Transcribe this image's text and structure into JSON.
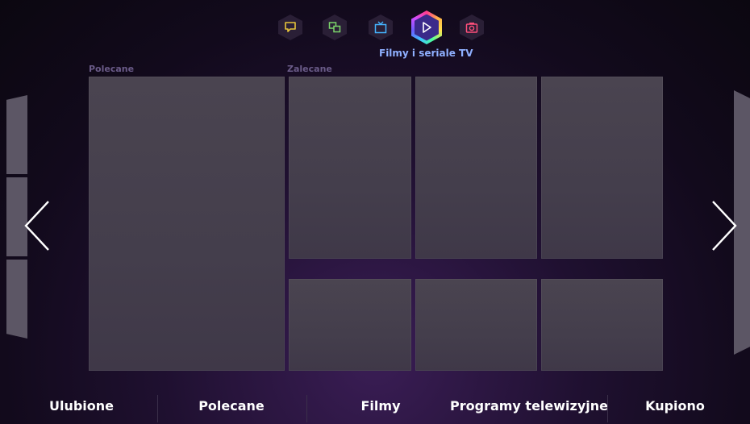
{
  "top_nav": {
    "items": [
      {
        "icon": "chat-bubble-icon",
        "color": "#e8c53a"
      },
      {
        "icon": "multiscreen-icon",
        "color": "#7bd46a"
      },
      {
        "icon": "tv-icon",
        "color": "#45b4ff"
      },
      {
        "icon": "play-icon",
        "color": "#ffffff",
        "active": true
      },
      {
        "icon": "camera-icon",
        "color": "#ff4f7a"
      }
    ],
    "active_caption": "Filmy i seriale TV"
  },
  "sections": {
    "featured_label": "Polecane",
    "recommended_label": "Zalecane"
  },
  "bottom_tabs": [
    {
      "label": "Ulubione"
    },
    {
      "label": "Polecane"
    },
    {
      "label": "Filmy"
    },
    {
      "label": "Programy telewizyjne"
    },
    {
      "label": "Kupiono"
    }
  ]
}
